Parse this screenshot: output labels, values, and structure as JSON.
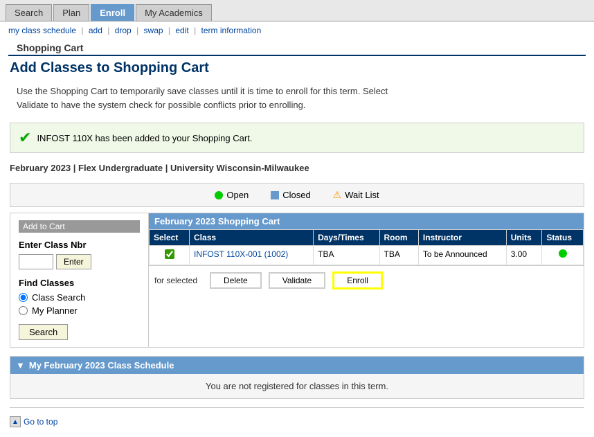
{
  "tabs": [
    {
      "id": "search",
      "label": "Search",
      "active": false
    },
    {
      "id": "plan",
      "label": "Plan",
      "active": false
    },
    {
      "id": "enroll",
      "label": "Enroll",
      "active": true
    },
    {
      "id": "my-academics",
      "label": "My Academics",
      "active": false
    }
  ],
  "breadcrumb": {
    "my_class_schedule": "my class schedule",
    "add": "add",
    "drop": "drop",
    "swap": "swap",
    "edit": "edit",
    "term_information": "term information"
  },
  "section_header": "Shopping Cart",
  "page_title": "Add Classes to Shopping Cart",
  "info_text_1": "Use the Shopping Cart to temporarily save classes until it is time to enroll for this term.  Select",
  "info_text_2": "Validate to have the system check for possible conflicts prior to enrolling.",
  "success_message": "INFOST  110X has been added to your Shopping Cart.",
  "term_info": "February 2023 | Flex Undergraduate | University Wisconsin-Milwaukee",
  "legend": {
    "open_label": "Open",
    "closed_label": "Closed",
    "waitlist_label": "Wait List"
  },
  "left_panel": {
    "title": "Add to Cart",
    "enter_class_label": "Enter Class Nbr",
    "enter_btn_label": "Enter",
    "find_classes_label": "Find Classes",
    "class_search_label": "Class Search",
    "my_planner_label": "My Planner",
    "search_btn_label": "Search"
  },
  "cart": {
    "header": "February 2023 Shopping Cart",
    "columns": [
      "Select",
      "Class",
      "Days/Times",
      "Room",
      "Instructor",
      "Units",
      "Status"
    ],
    "rows": [
      {
        "checked": true,
        "class_link": "INFOST 110X-001 (1002)",
        "days_times": "TBA",
        "room": "TBA",
        "instructor": "To be Announced",
        "units": "3.00",
        "status": "open"
      }
    ],
    "for_selected_label": "for selected",
    "delete_btn": "Delete",
    "validate_btn": "Validate",
    "enroll_btn": "Enroll"
  },
  "schedule_section": {
    "header": "My February 2023 Class Schedule",
    "body_text": "You are not registered for classes in this term."
  },
  "footer": {
    "go_to_top": "Go to top"
  }
}
